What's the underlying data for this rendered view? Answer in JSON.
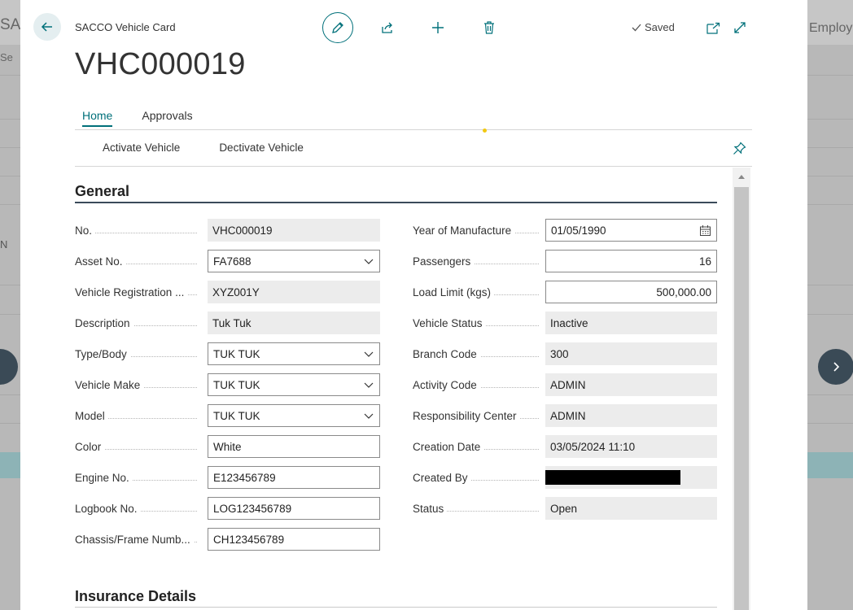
{
  "background": {
    "title_left": "SACCO",
    "title_right": "Employee Self",
    "search": "Se",
    "row_letter": "N"
  },
  "header": {
    "caption": "SACCO Vehicle Card",
    "record_no": "VHC000019",
    "status": "Saved"
  },
  "tabs": [
    {
      "label": "Home",
      "active": true
    },
    {
      "label": "Approvals",
      "active": false
    }
  ],
  "actions": [
    "Activate Vehicle",
    "Dectivate Vehicle"
  ],
  "sections": {
    "general": "General",
    "insurance": "Insurance Details"
  },
  "left_fields": [
    {
      "label": "No.",
      "value": "VHC000019",
      "kind": "readonly"
    },
    {
      "label": "Asset No.",
      "value": "FA7688",
      "kind": "dropdown"
    },
    {
      "label": "Vehicle Registration ...",
      "value": "XYZ001Y",
      "kind": "readonly"
    },
    {
      "label": "Description",
      "value": "Tuk Tuk",
      "kind": "readonly"
    },
    {
      "label": "Type/Body",
      "value": "TUK TUK",
      "kind": "dropdown"
    },
    {
      "label": "Vehicle Make",
      "value": "TUK TUK",
      "kind": "dropdown"
    },
    {
      "label": "Model",
      "value": "TUK TUK",
      "kind": "dropdown"
    },
    {
      "label": "Color",
      "value": "White",
      "kind": "edit"
    },
    {
      "label": "Engine No.",
      "value": "E123456789",
      "kind": "edit"
    },
    {
      "label": "Logbook No.",
      "value": "LOG123456789",
      "kind": "edit"
    },
    {
      "label": "Chassis/Frame Numb...",
      "value": "CH123456789",
      "kind": "edit"
    }
  ],
  "right_fields": [
    {
      "label": "Year of Manufacture",
      "value": "01/05/1990",
      "kind": "date"
    },
    {
      "label": "Passengers",
      "value": "16",
      "kind": "number"
    },
    {
      "label": "Load Limit (kgs)",
      "value": "500,000.00",
      "kind": "number"
    },
    {
      "label": "Vehicle Status",
      "value": "Inactive",
      "kind": "readonly"
    },
    {
      "label": "Branch Code",
      "value": "300",
      "kind": "readonly"
    },
    {
      "label": "Activity Code",
      "value": "ADMIN",
      "kind": "readonly"
    },
    {
      "label": "Responsibility Center",
      "value": "ADMIN",
      "kind": "readonly"
    },
    {
      "label": "Creation Date",
      "value": "03/05/2024 11:10",
      "kind": "readonly"
    },
    {
      "label": "Created By",
      "value": "",
      "kind": "redacted"
    },
    {
      "label": "Status",
      "value": "Open",
      "kind": "readonly"
    }
  ],
  "colors": {
    "accent": "#00707a",
    "readonly_bg": "#ececec",
    "section_rule": "#3b4a5a"
  },
  "icons": [
    "back-arrow-icon",
    "pencil-icon",
    "share-icon",
    "plus-icon",
    "trash-icon",
    "checkmark-icon",
    "popout-icon",
    "expand-icon",
    "pin-icon",
    "chevron-down-icon",
    "calendar-icon",
    "chevron-right-icon",
    "chevron-up-icon"
  ]
}
